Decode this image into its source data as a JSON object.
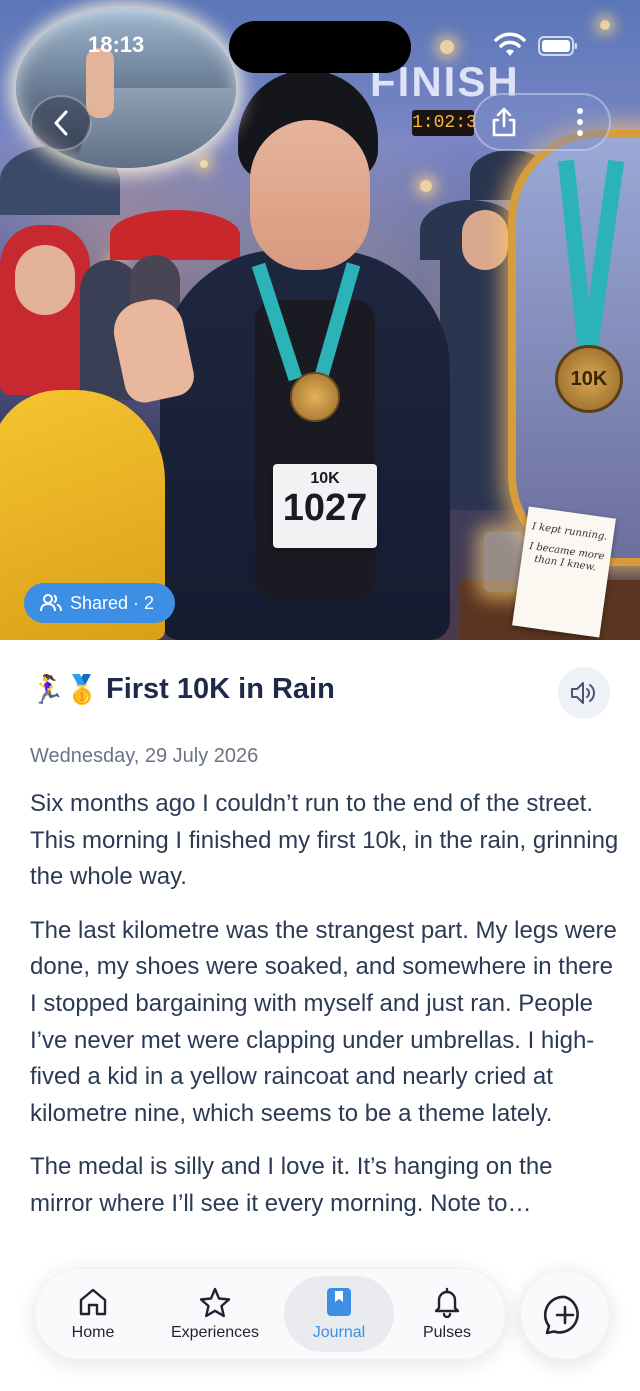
{
  "status_bar": {
    "time": "18:13"
  },
  "hero": {
    "finish_banner": "FINISH",
    "finish_clock": "1:02:3",
    "bib_distance": "10K",
    "bib_number": "1027",
    "medal_text": "10K",
    "note_lines": [
      "I kept running.",
      "I became more than I knew."
    ],
    "shared_label": "Shared · 2"
  },
  "entry": {
    "title_emoji": "🏃‍♀️🥇",
    "title": "First 10K in Rain",
    "date": "Wednesday, 29 July 2026",
    "paragraphs": [
      "Six months ago I couldn’t run to the end of the street. This morning I finished my first 10k, in the rain, grinning the whole way.",
      "The last kilometre was the strangest part. My legs were done, my shoes were soaked, and somewhere in there I stopped bargaining with myself and just ran. People I’ve never met were clapping under umbrellas. I high-fived a kid in a yellow raincoat and nearly cried at kilometre nine, which seems to be a theme lately.",
      "The medal is silly and I love it. It’s hanging on the mirror where I’ll see it every morning. Note to…"
    ]
  },
  "tabbar": {
    "tabs": [
      {
        "label": "Home",
        "icon": "home-icon"
      },
      {
        "label": "Experiences",
        "icon": "star-icon"
      },
      {
        "label": "Journal",
        "icon": "bookmark-icon",
        "active": true
      },
      {
        "label": "Pulses",
        "icon": "bell-icon"
      }
    ],
    "compose_icon": "plus-bubble-icon"
  },
  "colors": {
    "accent": "#3d8fe6",
    "text": "#2b3a55",
    "muted": "#6b7386"
  }
}
